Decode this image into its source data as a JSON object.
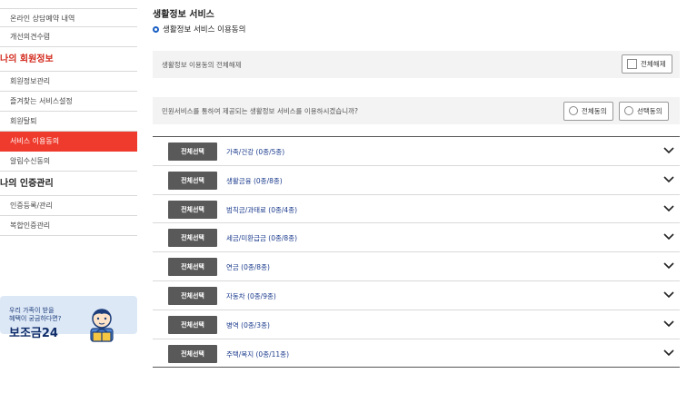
{
  "sidebar": {
    "items_top": [
      "온라인 상담예약 내역",
      "개선의견수렴"
    ],
    "section1": "나의 회원정보",
    "items_member": [
      "회원정보관리",
      "즐겨찾는 서비스설정",
      "회원탈퇴",
      "서비스 이용동의",
      "알림수신동의"
    ],
    "section2": "나의 인증관리",
    "items_auth": [
      "인증등록/관리",
      "복합인증관리"
    ],
    "banner": {
      "line1": "우리 가족이 받을",
      "line2": "혜택이 궁금하다면?",
      "title": "보조금24"
    }
  },
  "main": {
    "title": "생활정보 서비스",
    "subtitle": "생활정보 서비스 이용동의",
    "revoke_box": {
      "text": "생활정보 이용동의 전체해제",
      "button": "전체해제"
    },
    "consent_box": {
      "text": "민원서비스를 통하여 제공되는 생활정보 서비스를 이용하시겠습니까?",
      "all_agree": "전체동의",
      "select_agree": "선택동의"
    },
    "select_all_label": "전체선택",
    "categories": [
      "가족/건강 (0종/5종)",
      "생활금융 (0종/8종)",
      "범칙금/과태료 (0종/4종)",
      "세금/미환급금 (0종/8종)",
      "연금 (0종/8종)",
      "자동차 (0종/9종)",
      "병역 (0종/3종)",
      "주택/복지 (0종/11종)"
    ]
  },
  "colors": {
    "accent_red": "#ef3b2d",
    "section_red": "#d32a1e",
    "link_blue": "#1a3a8c",
    "select_button": "#595959",
    "banner_bg": "#dde8f7"
  }
}
